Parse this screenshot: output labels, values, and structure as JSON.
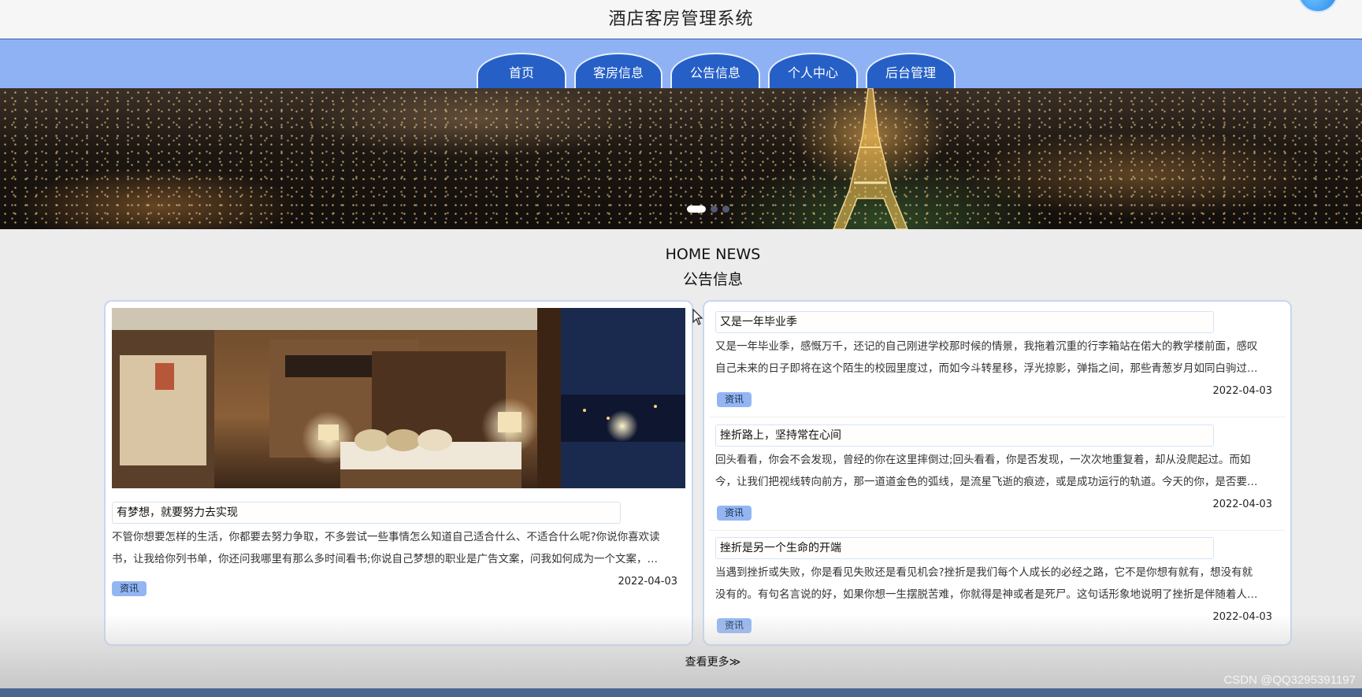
{
  "site": {
    "title": "酒店客房管理系统"
  },
  "nav": {
    "items": [
      {
        "label": "首页"
      },
      {
        "label": "客房信息"
      },
      {
        "label": "公告信息"
      },
      {
        "label": "个人中心"
      },
      {
        "label": "后台管理"
      }
    ]
  },
  "banner": {
    "slide_count": 3,
    "active_slide": 1
  },
  "news": {
    "heading_en": "HOME NEWS",
    "heading_cn": "公告信息",
    "featured": {
      "title": "有梦想，就要努力去实现",
      "summary_line1": "不管你想要怎样的生活，你都要去努力争取，不多尝试一些事情怎么知道自己适合什么、不适合什么呢?你说你喜欢读",
      "summary_line2": "书，让我给你列书单，你还问我哪里有那么多时间看书;你说自己梦想的职业是广告文案，问我如何成为一个文案，…",
      "tag": "资讯",
      "date": "2022-04-03"
    },
    "items": [
      {
        "title": "又是一年毕业季",
        "summary_line1": "又是一年毕业季，感慨万千，还记的自己刚进学校那时候的情景，我拖着沉重的行李箱站在偌大的教学楼前面，感叹",
        "summary_line2": "自己未来的日子即将在这个陌生的校园里度过，而如今斗转星移，浮光掠影，弹指之间，那些青葱岁月如同白驹过…",
        "tag": "资讯",
        "date": "2022-04-03"
      },
      {
        "title": "挫折路上，坚持常在心间",
        "summary_line1": "回头看看，你会不会发现，曾经的你在这里摔倒过;回头看看，你是否发现，一次次地重复着，却从没爬起过。而如",
        "summary_line2": "今，让我们把视线转向前方，那一道道金色的弧线，是流星飞逝的痕迹，或是成功运行的轨道。今天的你，是否要…",
        "tag": "资讯",
        "date": "2022-04-03"
      },
      {
        "title": "挫折是另一个生命的开端",
        "summary_line1": "当遇到挫折或失败，你是看见失败还是看见机会?挫折是我们每个人成长的必经之路，它不是你想有就有，想没有就",
        "summary_line2": "没有的。有句名言说的好，如果你想一生摆脱苦难，你就得是神或者是死尸。这句话形象地说明了挫折是伴随着人…",
        "tag": "资讯",
        "date": "2022-04-03"
      }
    ],
    "more_label": "查看更多≫"
  },
  "watermark": "CSDN @QQ3295391197",
  "colors": {
    "nav_bg": "#8fb2f5",
    "nav_tab": "#2660c7",
    "tag_bg": "#93b6f3",
    "card_border": "#c7d6f3",
    "footer": "#4c6590"
  }
}
